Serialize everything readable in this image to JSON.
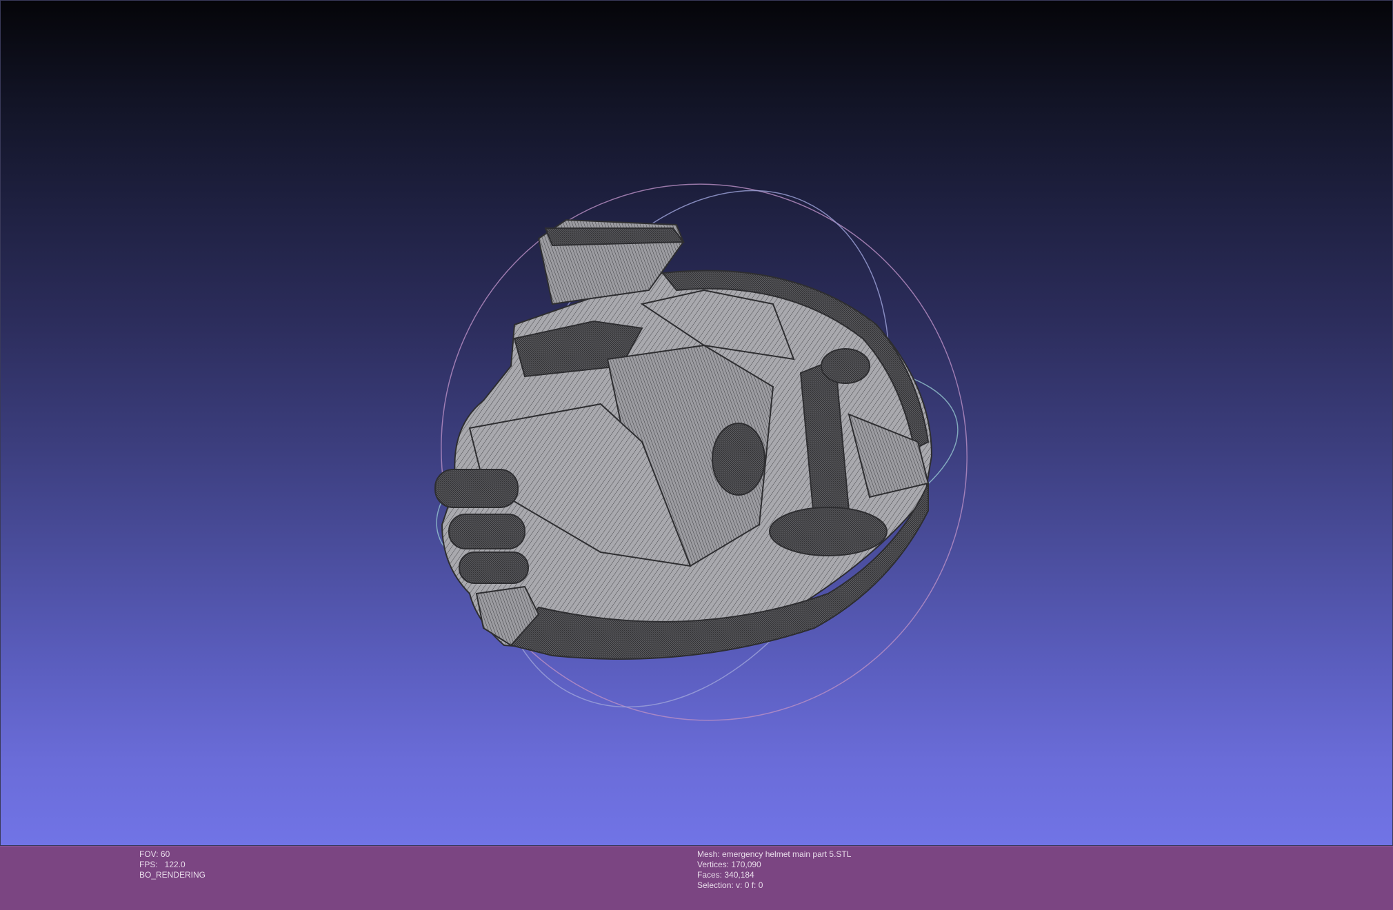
{
  "viewport": {
    "model_name": "mesh-render"
  },
  "status_left": {
    "fov": "FOV: 60",
    "fps": "FPS:   122.0",
    "mode": "BO_RENDERING"
  },
  "status_right": {
    "mesh": "Mesh: emergency helmet main part 5.STL",
    "vertices": "Vertices: 170,090",
    "faces": "Faces: 340,184",
    "selection": "Selection: v: 0 f: 0"
  },
  "colors": {
    "status_bg": "#7b4582",
    "mesh_light": "#b9b9bd",
    "mesh_dark": "#3a3a3c"
  }
}
